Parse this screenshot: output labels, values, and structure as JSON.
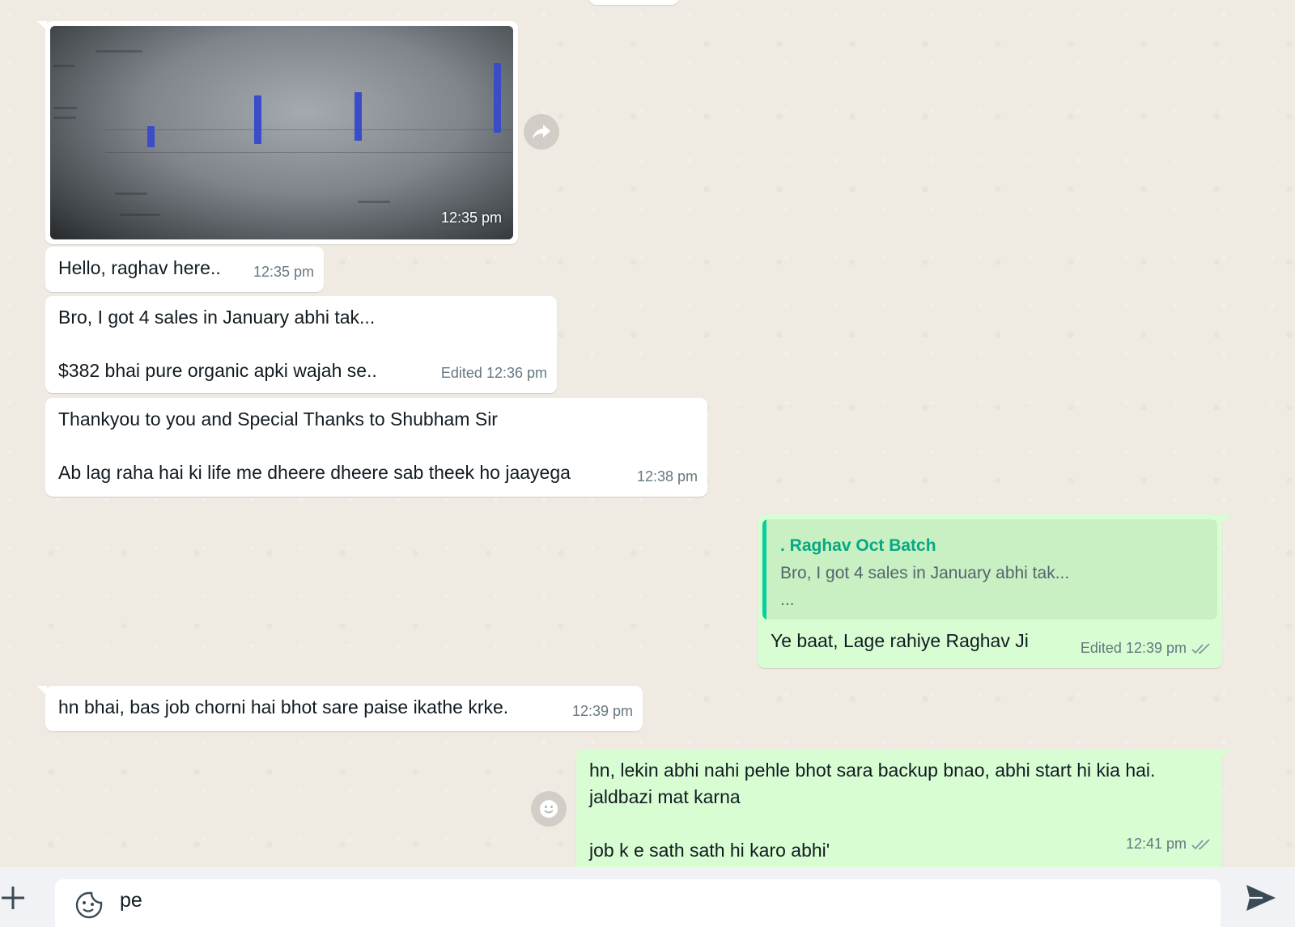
{
  "messages": [
    {
      "id": "img",
      "direction": "in",
      "type": "image",
      "time": "12:35 pm"
    },
    {
      "id": "m1",
      "direction": "in",
      "text": "Hello, raghav here..",
      "meta": "12:35 pm"
    },
    {
      "id": "m2",
      "direction": "in",
      "text": "Bro, I got 4 sales in January abhi tak...\n\n$382 bhai pure organic apki wajah se..",
      "meta": "Edited 12:36 pm"
    },
    {
      "id": "m3",
      "direction": "in",
      "text": "Thankyou to you and Special Thanks to Shubham Sir\n\nAb lag raha hai ki life me dheere dheere sab theek ho jaayega",
      "meta": "12:38 pm"
    },
    {
      "id": "m4",
      "direction": "out",
      "quote_author": ". Raghav Oct Batch",
      "quote_text": "Bro, I got 4 sales in January abhi tak...\n...",
      "text": "Ye baat, Lage rahiye Raghav Ji",
      "meta": "Edited 12:39 pm",
      "status": "double-check-read"
    },
    {
      "id": "m5",
      "direction": "in",
      "text": "hn bhai, bas job chorni hai bhot sare paise ikathe krke.",
      "meta": "12:39 pm"
    },
    {
      "id": "m6",
      "direction": "out",
      "text": "hn, lekin abhi nahi pehle bhot sara backup bnao, abhi start hi kia hai.\njaldbazi mat karna\n\njob k e sath sath hi karo abhi'",
      "meta": "12:41 pm",
      "status": "double-check-read"
    }
  ],
  "composer": {
    "value": "pe"
  },
  "colors": {
    "chat_bg": "#efeae2",
    "incoming_bubble": "#ffffff",
    "outgoing_bubble": "#d9fdd3",
    "accent": "#06cf9c",
    "meta_text": "#667781"
  },
  "icons": {
    "forward": "forward-icon",
    "reaction": "emoji-icon",
    "attach": "plus-icon",
    "sticker": "sticker-icon",
    "send": "send-icon",
    "ticks": "double-check-icon"
  }
}
